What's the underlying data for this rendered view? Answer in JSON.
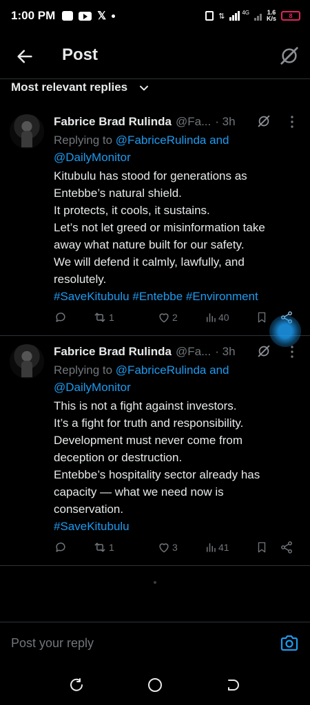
{
  "status_bar": {
    "time": "1:00 PM",
    "network_type": "4G",
    "net_speed_value": "1.6",
    "net_speed_unit": "K/s",
    "battery": "8"
  },
  "header": {
    "title": "Post"
  },
  "sort": {
    "label": "Most relevant replies"
  },
  "posts": [
    {
      "author": "Fabrice Brad Rulinda",
      "handle": "@Fa...",
      "time": "· 3h",
      "replying_prefix": "Replying to",
      "replying_mentions": "@FabriceRulinda and @DailyMonitor",
      "lines": [
        "Kitubulu has stood for generations as",
        "Entebbe’s natural shield.",
        "It protects, it cools, it sustains.",
        "Let’s not let greed or misinformation take",
        "away what nature built for our safety.",
        "We will defend it  calmly, lawfully, and",
        "resolutely."
      ],
      "hashtags": "#SaveKitubulu #Entebbe #Environment",
      "stats": {
        "replies": "",
        "reposts": "1",
        "likes": "2",
        "views": "40"
      }
    },
    {
      "author": "Fabrice Brad Rulinda",
      "handle": "@Fa...",
      "time": "· 3h",
      "replying_prefix": "Replying to",
      "replying_mentions": "@FabriceRulinda and @DailyMonitor",
      "lines": [
        "This is not a fight against investors.",
        "It’s a fight for truth and responsibility.",
        "Development must never come from",
        "deception or destruction.",
        "Entebbe’s hospitality sector already has",
        "capacity — what we need now is",
        "conservation."
      ],
      "hashtags": "#SaveKitubulu",
      "stats": {
        "replies": "",
        "reposts": "1",
        "likes": "3",
        "views": "41"
      }
    }
  ],
  "composer": {
    "placeholder": "Post your reply"
  },
  "icons": {
    "back": "arrow-left-icon",
    "grok": "grok-icon",
    "camera": "camera-icon"
  },
  "colors": {
    "background": "#000000",
    "accent": "#1d9bf0",
    "muted": "#71767b",
    "text": "#e7e9ea",
    "divider": "#2f3336"
  }
}
